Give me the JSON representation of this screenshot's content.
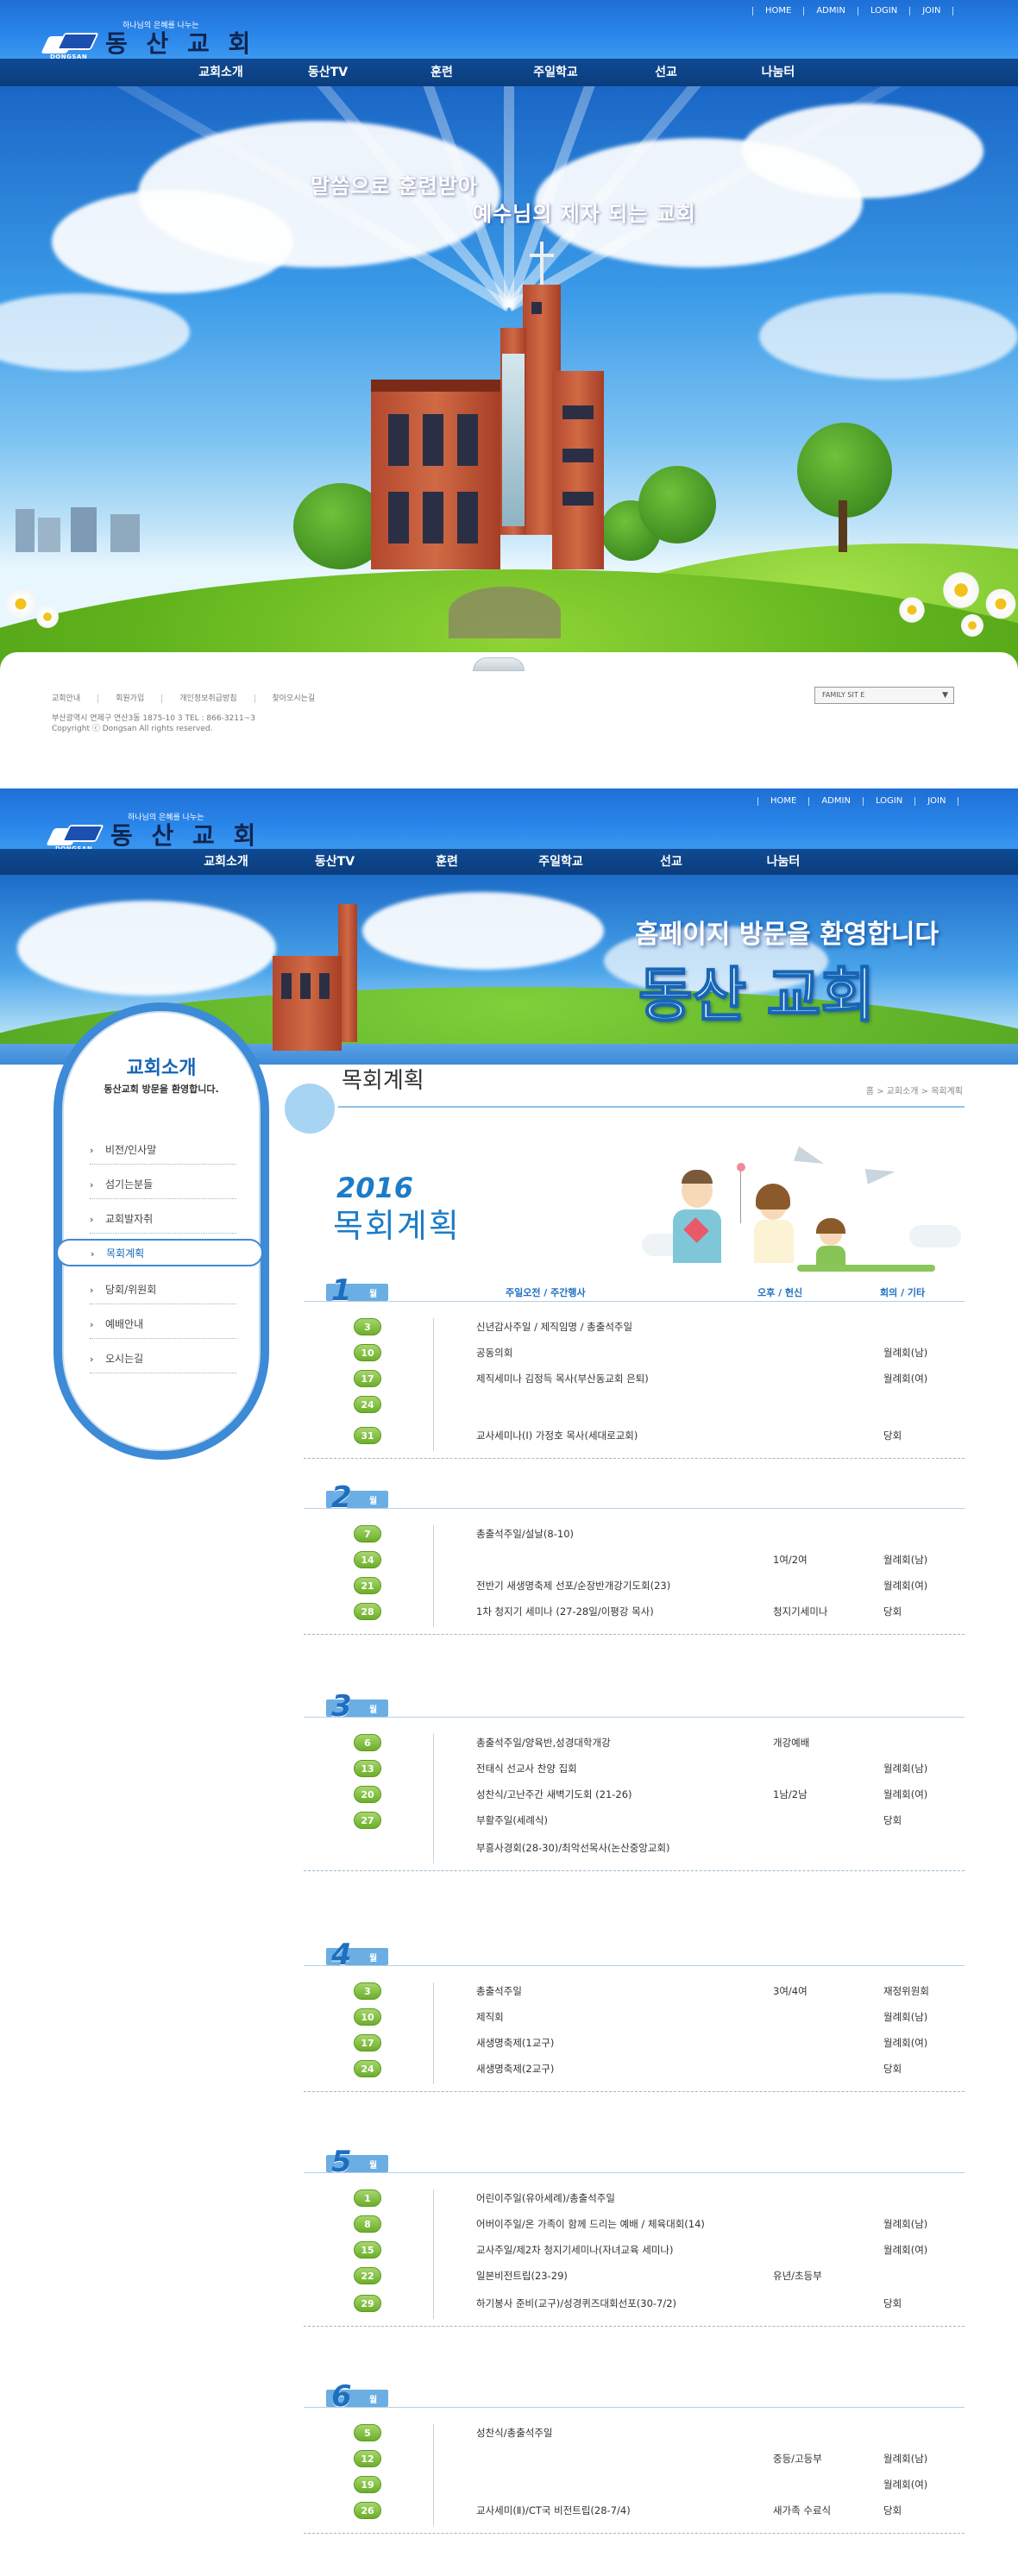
{
  "main": {
    "logo": {
      "mark_text": "DONGSAN",
      "slogan": "하나님의 은혜를 나누는",
      "name": "동 산 교 회"
    },
    "util_links": [
      "HOME",
      "ADMIN",
      "LOGIN",
      "JOIN"
    ],
    "gnb": [
      "교회소개",
      "동산TV",
      "훈련",
      "주일학교",
      "선교",
      "나눔터"
    ],
    "hero": {
      "line1": "말씀으로 훈련받아",
      "line2": "예수님의 제자 되는 교회"
    },
    "footer": {
      "links": [
        "교회안내",
        "회원가입",
        "개인정보취급방침",
        "찾아오시는길"
      ],
      "address": "부산광역시 연제구 연산3동 1875-10 3 TEL : 866-3211~3",
      "copyright": "Copyright ⓒ Dongsan All rights reserved.",
      "family_site": "FAMILY SIT E"
    }
  },
  "sub": {
    "logo": {
      "mark_text": "DONGSAN",
      "slogan": "하나님의 은혜를 나누는",
      "name": "동 산 교 회"
    },
    "util_links": [
      "HOME",
      "ADMIN",
      "LOGIN",
      "JOIN"
    ],
    "gnb": [
      "교회소개",
      "동산TV",
      "훈련",
      "주일학교",
      "선교",
      "나눔터"
    ],
    "banner": {
      "welcome": "홈페이지 방문을 환영합니다",
      "name": "동산 교회"
    },
    "lnb": {
      "title": "교회소개",
      "desc": "동산교회 방문을 환영합니다.",
      "items": [
        "비전/인사말",
        "섬기는분들",
        "교회발자취",
        "목회계획",
        "당회/위원회",
        "예배안내",
        "오시는길"
      ],
      "active_index": 3
    },
    "content": {
      "title": "목회계획",
      "breadcrumb": "홈 > 교회소개 > 목회계획",
      "plan_year": "2016",
      "plan_title": "목회계획"
    },
    "columns": {
      "main": "주일오전 / 주간행사",
      "pm": "오후 / 헌신",
      "meeting": "회의 / 기타"
    },
    "month_unit": "월",
    "months": [
      {
        "month": "1",
        "rows": [
          {
            "day": "3",
            "event": "신년감사주일 / 제직임명 / 총출석주일",
            "pm": "",
            "meeting": ""
          },
          {
            "day": "10",
            "event": "공동의회",
            "pm": "",
            "meeting": "월례회(남)"
          },
          {
            "day": "17",
            "event": "제직세미나 김정득 목사(부산동교회 은퇴)",
            "pm": "",
            "meeting": "월례회(여)"
          },
          {
            "day": "24",
            "event": "",
            "pm": "",
            "meeting": ""
          },
          {
            "day": "31",
            "event": "교사세미나(Ⅰ) 가정호 목사(세대로교회)",
            "pm": "",
            "meeting": "당회"
          }
        ]
      },
      {
        "month": "2",
        "rows": [
          {
            "day": "7",
            "event": "총출석주일/설날(8-10)",
            "pm": "",
            "meeting": ""
          },
          {
            "day": "14",
            "event": "",
            "pm": "1여/2여",
            "meeting": "월례회(남)"
          },
          {
            "day": "21",
            "event": "전반기 새생명축제 선포/순장반개강기도회(23)",
            "pm": "",
            "meeting": "월례회(여)"
          },
          {
            "day": "28",
            "event": "1차 청지기 세미나 (27-28일/이평강 목사)",
            "pm": "청지기세미나",
            "meeting": "당회"
          }
        ]
      },
      {
        "month": "3",
        "rows": [
          {
            "day": "6",
            "event": "총출석주일/양육반,성경대학개강",
            "pm": "개강예배",
            "meeting": ""
          },
          {
            "day": "13",
            "event": "전태식 선교사 찬양 집회",
            "pm": "",
            "meeting": "월례회(남)"
          },
          {
            "day": "20",
            "event": "성찬식/고난주간 새벽기도회 (21-26)",
            "pm": "1남/2남",
            "meeting": "월례회(여)"
          },
          {
            "day": "27",
            "event": "부활주일(세례식)",
            "pm": "",
            "meeting": "당회"
          },
          {
            "day": "",
            "event": "부흥사경회(28-30)/최악선목사(논산중앙교회)",
            "pm": "",
            "meeting": ""
          }
        ]
      },
      {
        "month": "4",
        "rows": [
          {
            "day": "3",
            "event": "총출석주일",
            "pm": "3여/4여",
            "meeting": "재정위원회"
          },
          {
            "day": "10",
            "event": "제직회",
            "pm": "",
            "meeting": "월례회(남)"
          },
          {
            "day": "17",
            "event": "새생명축제(1교구)",
            "pm": "",
            "meeting": "월례회(여)"
          },
          {
            "day": "24",
            "event": "새생명축제(2교구)",
            "pm": "",
            "meeting": "당회"
          }
        ]
      },
      {
        "month": "5",
        "rows": [
          {
            "day": "1",
            "event": "어린이주일(유아세례)/총출석주일",
            "pm": "",
            "meeting": ""
          },
          {
            "day": "8",
            "event": "어버이주일/온 가족이 함께 드리는 예배 / 체육대회(14)",
            "pm": "",
            "meeting": "월례회(남)"
          },
          {
            "day": "15",
            "event": "교사주일/제2차 청지기세미나(자녀교육 세미나)",
            "pm": "",
            "meeting": "월례회(여)"
          },
          {
            "day": "22",
            "event": "일본비전트립(23-29)",
            "pm": "유년/초등부",
            "meeting": ""
          },
          {
            "day": "29",
            "event": "하기봉사 준비(교구)/성경퀴즈대회선포(30-7/2)",
            "pm": "",
            "meeting": "당회"
          }
        ]
      },
      {
        "month": "6",
        "rows": [
          {
            "day": "5",
            "event": "성찬식/총출석주일",
            "pm": "",
            "meeting": ""
          },
          {
            "day": "12",
            "event": "",
            "pm": "중등/고등부",
            "meeting": "월례회(남)"
          },
          {
            "day": "19",
            "event": "",
            "pm": "",
            "meeting": "월례회(여)"
          },
          {
            "day": "26",
            "event": "교사세미(Ⅱ)/CT국 비전트립(28-7/4)",
            "pm": "새가족 수료식",
            "meeting": "당회"
          }
        ]
      }
    ]
  }
}
